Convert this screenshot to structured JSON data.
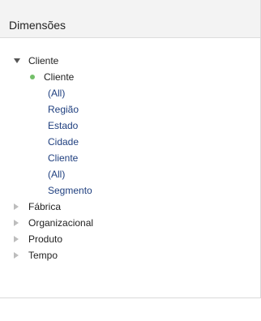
{
  "header": {
    "title": "Dimensões"
  },
  "tree": {
    "items": [
      {
        "label": "Cliente"
      },
      {
        "label": "Cliente"
      },
      {
        "label": "(All)"
      },
      {
        "label": "Região"
      },
      {
        "label": "Estado"
      },
      {
        "label": "Cidade"
      },
      {
        "label": "Cliente"
      },
      {
        "label": "(All)"
      },
      {
        "label": "Segmento"
      },
      {
        "label": "Fábrica"
      },
      {
        "label": "Organizacional"
      },
      {
        "label": "Produto"
      },
      {
        "label": "Tempo"
      }
    ]
  }
}
